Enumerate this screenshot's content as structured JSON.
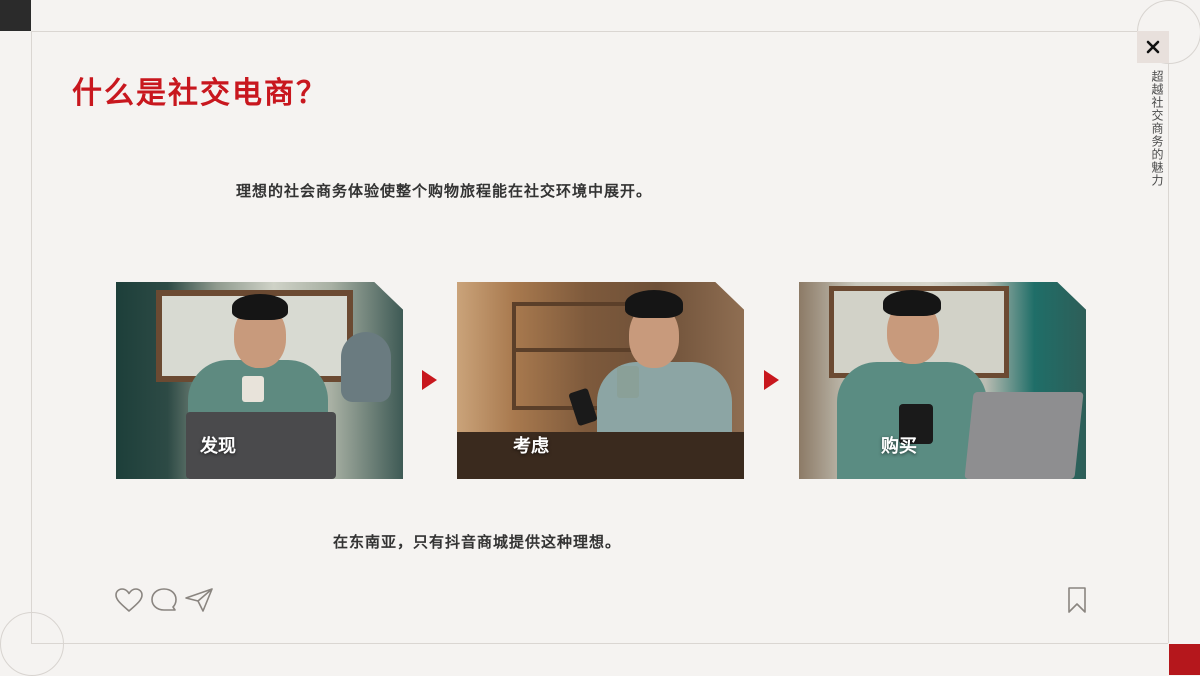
{
  "title": "什么是社交电商？",
  "intro": "理想的社会商务体验使整个购物旅程能在社交环境中展开。",
  "outro": "在东南亚，只有抖音商城提供这种理想。",
  "side_label": "超越社交商务的魅力",
  "close_icon": "close-icon",
  "colors": {
    "accent": "#c8171e",
    "background": "#f5f3f1",
    "dark": "#2b2b2b"
  },
  "steps": [
    {
      "label": "发现",
      "image": "man-drinking-coffee-at-laptop"
    },
    {
      "label": "考虑",
      "image": "man-drinking-coffee-looking-at-phone"
    },
    {
      "label": "购买",
      "image": "man-shopping-on-phone-at-laptop"
    }
  ],
  "bottom_icons": [
    "heart-icon",
    "comment-icon",
    "share-icon",
    "bookmark-icon"
  ]
}
